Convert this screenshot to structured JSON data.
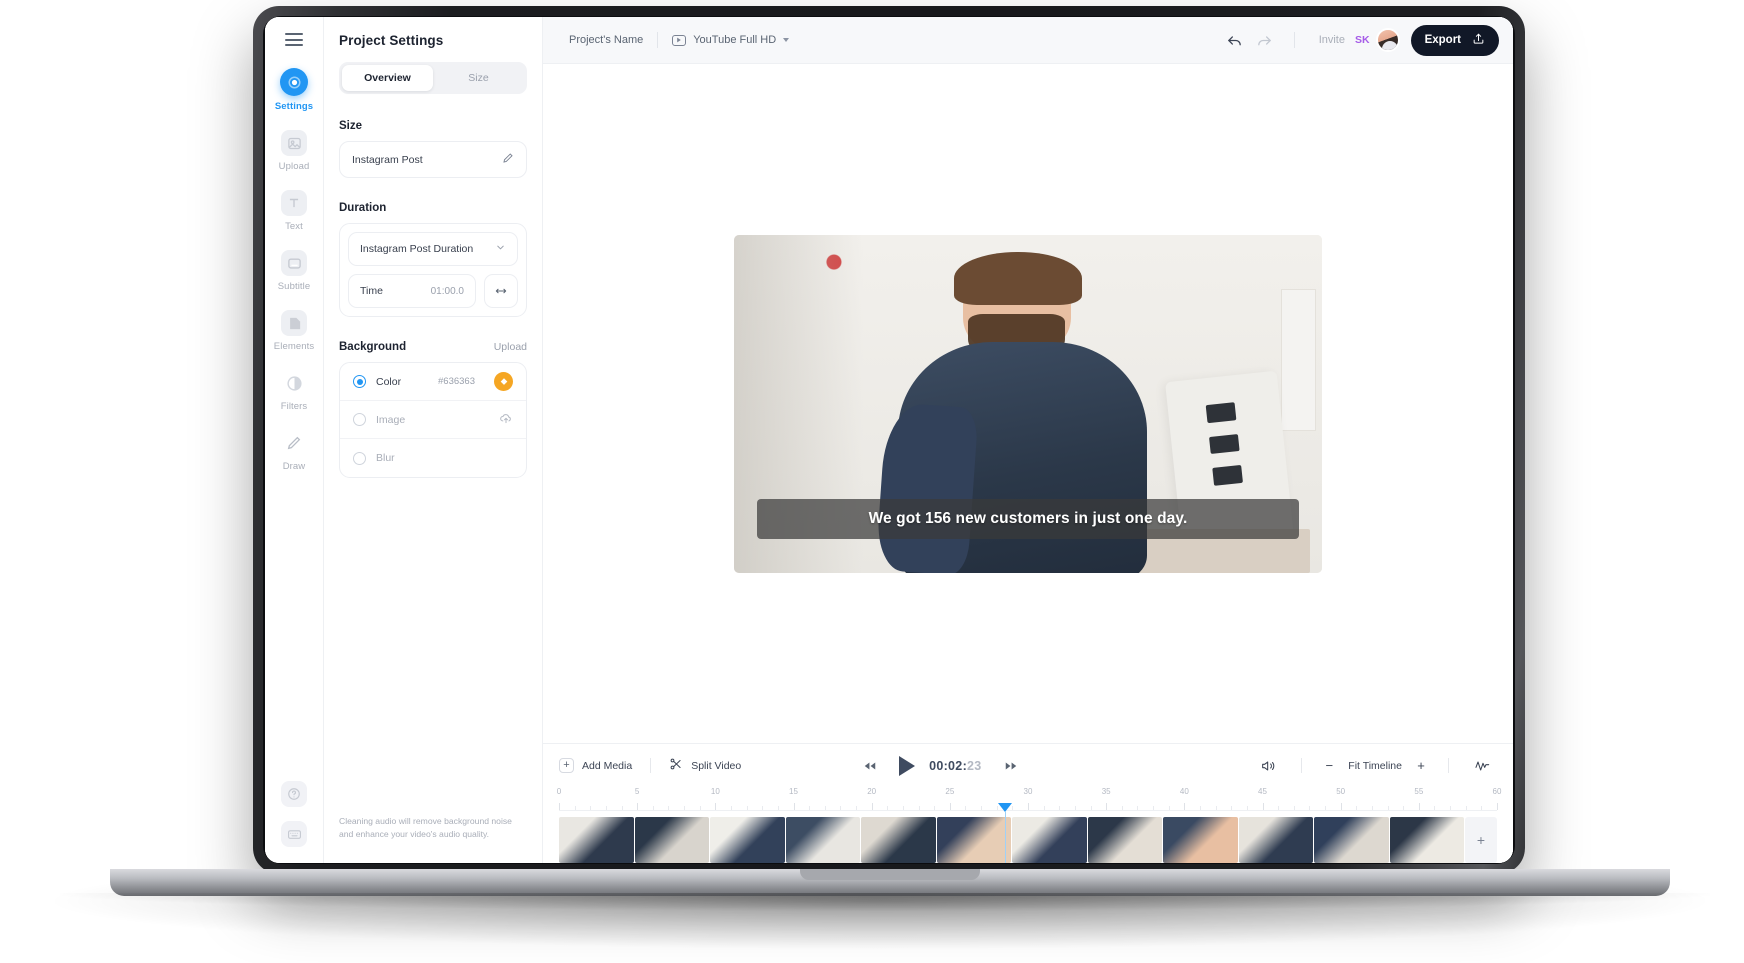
{
  "rail": {
    "menu_icon": "hamburger-icon",
    "items": [
      {
        "label": "Settings",
        "icon": "settings-gear-icon",
        "active": true
      },
      {
        "label": "Upload",
        "icon": "image-upload-icon",
        "active": false
      },
      {
        "label": "Text",
        "icon": "text-t-icon",
        "active": false
      },
      {
        "label": "Subtitle",
        "icon": "subtitle-icon",
        "active": false
      },
      {
        "label": "Elements",
        "icon": "elements-shape-icon",
        "active": false
      },
      {
        "label": "Filters",
        "icon": "filters-contrast-icon",
        "active": false
      },
      {
        "label": "Draw",
        "icon": "draw-pencil-icon",
        "active": false
      }
    ],
    "bottom": [
      {
        "icon": "help-question-icon"
      },
      {
        "icon": "keyboard-shortcuts-icon"
      }
    ]
  },
  "panel": {
    "title": "Project Settings",
    "tabs": [
      {
        "label": "Overview",
        "active": true
      },
      {
        "label": "Size",
        "active": false
      }
    ],
    "size": {
      "heading": "Size",
      "value": "Instagram Post",
      "edit_icon": "pencil-icon"
    },
    "duration": {
      "heading": "Duration",
      "preset": "Instagram Post Duration",
      "chevron_icon": "chevron-down-icon",
      "time_label": "Time",
      "time_value": "01:00.0",
      "stretch_icon": "arrows-horizontal-icon"
    },
    "background": {
      "heading": "Background",
      "upload_label": "Upload",
      "options": [
        {
          "label": "Color",
          "selected": true,
          "value": "#636363",
          "swatch_color": "#F5A623",
          "icon": "paint-bucket-icon"
        },
        {
          "label": "Image",
          "selected": false,
          "value": "",
          "icon": "cloud-upload-icon"
        },
        {
          "label": "Blur",
          "selected": false,
          "value": "",
          "icon": ""
        }
      ]
    },
    "disclaimer": "Cleaning audio will remove background noise and enhance your video's audio quality."
  },
  "topbar": {
    "project_name": "Project's Name",
    "ratio_label": "YouTube Full HD",
    "ratio_icon": "youtube-play-icon",
    "undo_icon": "undo-arrow-icon",
    "redo_icon": "redo-arrow-icon",
    "invite_label": "Invite",
    "collaborator_initials": "SK",
    "avatar_name": "user-avatar",
    "export_label": "Export",
    "export_icon": "upload-share-icon",
    "export_bg": "#111827"
  },
  "canvas": {
    "subtitle_text": "We got 156 new customers in just one day."
  },
  "timeline": {
    "add_media_label": "Add Media",
    "add_media_icon": "plus-box-icon",
    "split_video_label": "Split Video",
    "split_video_icon": "scissors-icon",
    "prev_icon": "rewind-icon",
    "play_icon": "play-triangle-icon",
    "next_icon": "fast-forward-icon",
    "timecode": "00:02:",
    "timecode_frames": "23",
    "volume_icon": "speaker-volume-icon",
    "zoom_out_icon": "minus-icon",
    "zoom_label": "Fit Timeline",
    "zoom_in_icon": "plus-icon",
    "waveform_icon": "audio-waveform-icon",
    "ruler": {
      "labels": [
        0,
        5,
        10,
        15,
        20,
        25,
        30,
        35,
        40,
        45,
        50,
        55,
        60
      ],
      "max": 60,
      "playhead_position": 28.5
    },
    "add_clip_icon": "plus-icon",
    "frames": 12
  }
}
